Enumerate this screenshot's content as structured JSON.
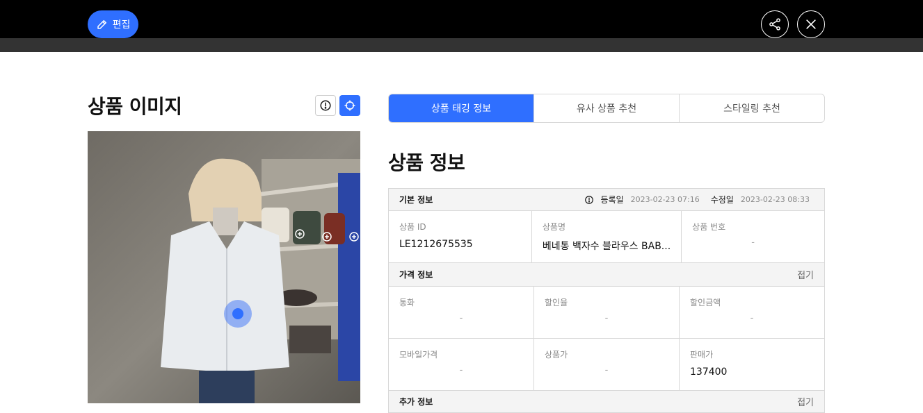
{
  "header": {
    "edit_label": "편집",
    "share_icon": "share-icon",
    "close_icon": "close-icon"
  },
  "image_panel": {
    "title": "상품 이미지",
    "info_icon": "info-icon",
    "focus_icon": "focus-icon"
  },
  "tabs": [
    {
      "label": "상품 태깅 정보",
      "active": true
    },
    {
      "label": "유사 상품 추천",
      "active": false
    },
    {
      "label": "스타일링 추천",
      "active": false
    }
  ],
  "product_info": {
    "title": "상품 정보",
    "basic": {
      "header": "기본 정보",
      "registered_label": "등록일",
      "registered_value": "2023-02-23 07:16",
      "modified_label": "수정일",
      "modified_value": "2023-02-23 08:33",
      "fields": [
        {
          "label": "상품 ID",
          "value": "LE1212675535"
        },
        {
          "label": "상품명",
          "value": "베네통 백자수 블라우스 BAB..."
        },
        {
          "label": "상품 번호",
          "value": "-"
        }
      ]
    },
    "price": {
      "header": "가격 정보",
      "collapse_label": "접기",
      "row1": [
        {
          "label": "통화",
          "value": "-"
        },
        {
          "label": "할인율",
          "value": "-"
        },
        {
          "label": "할인금액",
          "value": "-"
        }
      ],
      "row2": [
        {
          "label": "모바일가격",
          "value": "-"
        },
        {
          "label": "상품가",
          "value": "-"
        },
        {
          "label": "판매가",
          "value": "137400"
        }
      ]
    },
    "extra": {
      "header": "추가 정보",
      "collapse_label": "접기"
    }
  },
  "colors": {
    "accent": "#2f6fff",
    "topbar": "#000000",
    "subbar": "#333333"
  }
}
